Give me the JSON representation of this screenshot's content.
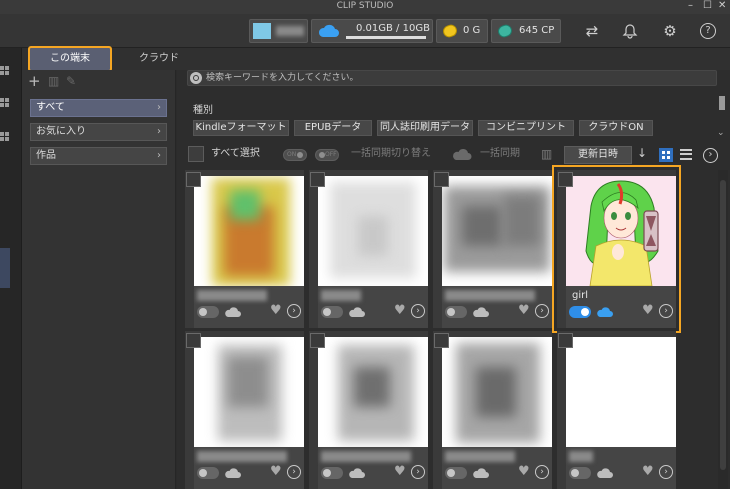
{
  "app": {
    "title": "CLIP STUDIO"
  },
  "window": {
    "minimize": "–",
    "maximize": "☐",
    "close": "✕"
  },
  "header": {
    "storage": "0.01GB / 10GB",
    "gold": "0 G",
    "cp": "645 CP",
    "icons": [
      "sync-icon",
      "bell-icon",
      "gear-icon",
      "help-icon"
    ],
    "help_label": "?"
  },
  "tabs": [
    {
      "label": "この端末",
      "selected": true
    },
    {
      "label": "クラウド",
      "selected": false
    }
  ],
  "sidebar": {
    "items": [
      {
        "label": "すべて",
        "selected": true
      },
      {
        "label": "お気に入り",
        "selected": false
      },
      {
        "label": "作品",
        "selected": false
      }
    ],
    "chevron": "›"
  },
  "search": {
    "placeholder": "検索キーワードを入力してください。"
  },
  "filters": {
    "label": "種別",
    "items": [
      "Kindleフォーマット",
      "EPUBデータ",
      "同人誌印刷用データ",
      "コンビニプリント",
      "クラウドON"
    ]
  },
  "toolbar": {
    "select_all": "すべて選択",
    "toggle_on": "ON",
    "toggle_off": "OFF",
    "batch_sync_switch": "一括同期切り替え",
    "batch_sync": "一括同期",
    "sort": "更新日時"
  },
  "works": [
    {
      "title": "",
      "sync_on": false,
      "blurred": true
    },
    {
      "title": "",
      "sync_on": false,
      "blurred": true
    },
    {
      "title": "",
      "sync_on": false,
      "blurred": true
    },
    {
      "title": "girl",
      "sync_on": true,
      "blurred": false
    },
    {
      "title": "",
      "sync_on": false,
      "blurred": true
    },
    {
      "title": "",
      "sync_on": false,
      "blurred": true
    },
    {
      "title": "",
      "sync_on": false,
      "blurred": true
    },
    {
      "title": "",
      "sync_on": false,
      "blurred": true
    }
  ],
  "card_actions": {
    "more": "›"
  },
  "colors": {
    "accent": "#2f8ee8",
    "highlight": "#f5a623",
    "selected_tab": "#5a5f72"
  }
}
